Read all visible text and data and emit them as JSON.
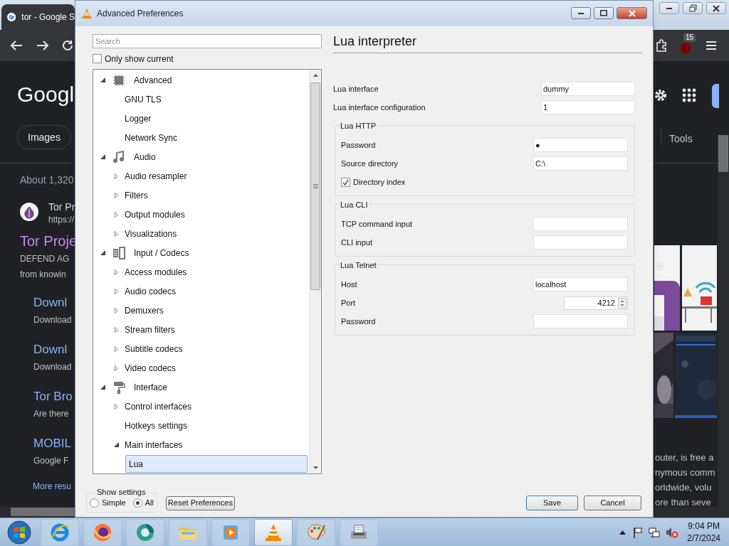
{
  "browser": {
    "tab_title": "tor - Google S",
    "logo": "Googl",
    "chips": [
      "Images",
      "Tools"
    ],
    "extension_badge": "15",
    "result_stats": "About 1,320",
    "result": {
      "site": "Tor Pr",
      "url": "https://",
      "title": "Tor Proje",
      "snippet": [
        "DEFEND AG",
        "from knowin"
      ]
    },
    "sublinks": [
      {
        "title": "Downl",
        "text": "Download"
      },
      {
        "title": "Downl",
        "text": "Download"
      },
      {
        "title": "Tor Bro",
        "text": "Are there"
      },
      {
        "title": "MOBIL",
        "text": "Google F"
      }
    ],
    "more": "More resu",
    "right_snippet": [
      "outer, is free a",
      "nymous comm",
      "orldwide, volu",
      "ore than seve"
    ]
  },
  "dialog": {
    "title": "Advanced Preferences",
    "search": {
      "placeholder": "Search"
    },
    "only_show_current": {
      "label": "Only show current",
      "checked": false
    },
    "tree": [
      {
        "label": "Advanced",
        "expanded": true,
        "selected": false,
        "children": [
          {
            "label": "GNU TLS",
            "selected": false
          },
          {
            "label": "Logger",
            "selected": false
          },
          {
            "label": "Network Sync",
            "selected": false
          }
        ]
      },
      {
        "label": "Audio",
        "expanded": true,
        "selected": false,
        "children": [
          {
            "label": "Audio resampler",
            "expanded": false,
            "selected": false
          },
          {
            "label": "Filters",
            "expanded": false,
            "selected": false
          },
          {
            "label": "Output modules",
            "expanded": false,
            "selected": false
          },
          {
            "label": "Visualizations",
            "expanded": false,
            "selected": false
          }
        ]
      },
      {
        "label": "Input / Codecs",
        "expanded": true,
        "selected": false,
        "children": [
          {
            "label": "Access modules",
            "expanded": false,
            "selected": false
          },
          {
            "label": "Audio codecs",
            "expanded": false,
            "selected": false
          },
          {
            "label": "Demuxers",
            "expanded": false,
            "selected": false
          },
          {
            "label": "Stream filters",
            "expanded": false,
            "selected": false
          },
          {
            "label": "Subtitle codecs",
            "expanded": false,
            "selected": false
          },
          {
            "label": "Video codecs",
            "expanded": false,
            "selected": false
          }
        ]
      },
      {
        "label": "Interface",
        "expanded": true,
        "selected": false,
        "children": [
          {
            "label": "Control interfaces",
            "expanded": false,
            "selected": false
          },
          {
            "label": "Hotkeys settings",
            "selected": false
          },
          {
            "label": "Main interfaces",
            "expanded": true,
            "selected": false,
            "children": [
              {
                "label": "Lua",
                "selected": true
              }
            ]
          }
        ]
      }
    ],
    "panel": {
      "title": "Lua interpreter",
      "fields": [
        {
          "kind": "text",
          "label": "Lua interface",
          "value": "dummy"
        },
        {
          "kind": "text",
          "label": "Lua interface configuration",
          "value": "1"
        }
      ],
      "groups": [
        {
          "title": "Lua HTTP",
          "fields": [
            {
              "kind": "text",
              "label": "Password",
              "value": "●"
            },
            {
              "kind": "text",
              "label": "Source directory",
              "value": "C:\\"
            },
            {
              "kind": "checkbox",
              "label": "Directory index",
              "checked": true
            }
          ]
        },
        {
          "title": "Lua CLI",
          "fields": [
            {
              "kind": "text",
              "label": "TCP command input"
            },
            {
              "kind": "text",
              "label": "CLI input"
            }
          ]
        },
        {
          "title": "Lua Telnet",
          "fields": [
            {
              "kind": "text",
              "label": "Host",
              "value": "localhost"
            },
            {
              "kind": "spin",
              "label": "Port",
              "value": "4212"
            },
            {
              "kind": "text",
              "label": "Password"
            }
          ]
        }
      ]
    },
    "show_settings": {
      "title": "Show settings",
      "options": [
        {
          "label": "Simple",
          "selected": false
        },
        {
          "label": "All",
          "selected": true
        }
      ]
    },
    "reset_button": "Reset Preferences",
    "buttons": [
      {
        "label": "Save",
        "default": true
      },
      {
        "label": "Cancel",
        "default": false
      }
    ]
  },
  "taskbar": {
    "apps": [
      {
        "selected": false
      },
      {
        "selected": false
      },
      {
        "selected": false
      },
      {
        "selected": false
      },
      {
        "selected": false
      },
      {
        "selected": true
      },
      {
        "selected": false
      },
      {
        "selected": false
      }
    ],
    "time": "9:04 PM",
    "date": "2/7/2024"
  }
}
